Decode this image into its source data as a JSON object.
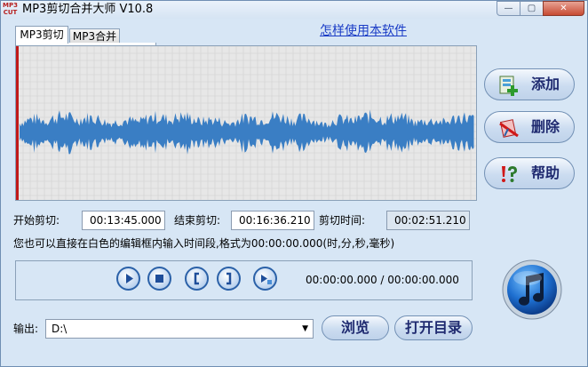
{
  "window": {
    "title": "MP3剪切合并大师 V10.8",
    "logo_top": "MP3",
    "logo_bottom": "CUT",
    "min_glyph": "—",
    "max_glyph": "▢",
    "close_glyph": "✕"
  },
  "tabs": [
    {
      "label": "MP3剪切"
    },
    {
      "label": "MP3合并"
    }
  ],
  "help_link": "怎样使用本软件",
  "side_buttons": {
    "add": "添加",
    "delete": "删除",
    "help": "帮助"
  },
  "times": {
    "start_label": "开始剪切:",
    "start_value": "00:13:45.000",
    "end_label": "结束剪切:",
    "end_value": "00:16:36.210",
    "duration_label": "剪切时间:",
    "duration_value": "00:02:51.210"
  },
  "hint": "您也可以直接在白色的编辑框内输入时间段,格式为00:00:00.000(时,分,秒,毫秒)",
  "player": {
    "position": "00:00:00.000 / 00:00:00.000"
  },
  "output": {
    "label": "输出:",
    "path": "D:\\",
    "arrow": "▼",
    "browse": "浏览",
    "open_dir": "打开目录"
  },
  "colors": {
    "waveform": "#3a7ec4",
    "cursor": "#c01a1a",
    "grid": "#cfcfcf",
    "panel_bg": "#d7e6f5"
  }
}
